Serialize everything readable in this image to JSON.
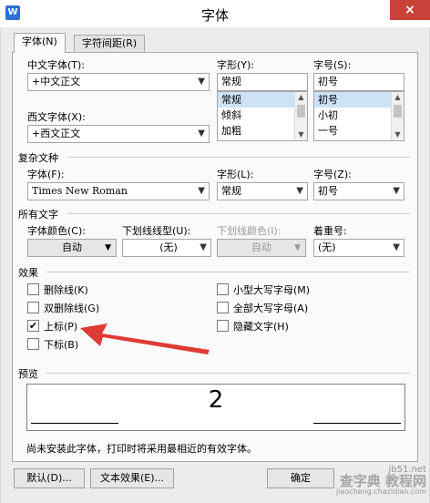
{
  "window": {
    "title": "字体",
    "close_glyph": "×",
    "app_icon_glyph": "W"
  },
  "tabs": [
    {
      "label": "字体(N)",
      "active": true
    },
    {
      "label": "字符间距(R)",
      "active": false
    }
  ],
  "chinese_font": {
    "label": "中文字体(T):",
    "value": "+中文正文"
  },
  "western_font": {
    "label": "西文字体(X):",
    "value": "+西文正文"
  },
  "style": {
    "label": "字形(Y):",
    "value": "常规",
    "options": [
      "常规",
      "倾斜",
      "加粗"
    ],
    "selected": "常规"
  },
  "size": {
    "label": "字号(S):",
    "value": "初号",
    "options": [
      "初号",
      "小初",
      "一号"
    ],
    "selected": "初号"
  },
  "complex": {
    "heading": "复杂文种",
    "font_label": "字体(F):",
    "font_value": "Times New Roman",
    "style_label": "字形(L):",
    "style_value": "常规",
    "size_label": "字号(Z):",
    "size_value": "初号"
  },
  "all_text": {
    "heading": "所有文字",
    "color_label": "字体颜色(C):",
    "color_value": "自动",
    "underline_label": "下划线线型(U):",
    "underline_value": "(无)",
    "underline_color_label": "下划线颜色(I):",
    "underline_color_value": "自动",
    "emphasis_label": "着重号:",
    "emphasis_value": "(无)"
  },
  "effects": {
    "heading": "效果",
    "strikethrough": {
      "label": "删除线(K)",
      "checked": false
    },
    "double_strikethrough": {
      "label": "双删除线(G)",
      "checked": false
    },
    "superscript": {
      "label": "上标(P)",
      "checked": true
    },
    "subscript": {
      "label": "下标(B)",
      "checked": false
    },
    "small_caps": {
      "label": "小型大写字母(M)",
      "checked": false
    },
    "all_caps": {
      "label": "全部大写字母(A)",
      "checked": false
    },
    "hidden": {
      "label": "隐藏文字(H)",
      "checked": false
    }
  },
  "preview": {
    "heading": "预览",
    "sample": "2"
  },
  "note": "尚未安装此字体，打印时将采用最相近的有效字体。",
  "buttons": {
    "default": "默认(D)...",
    "text_effects": "文本效果(E)...",
    "ok": "确定"
  },
  "glyphs": {
    "dropdown": "▼",
    "check": "✔",
    "scroll_up": "▲",
    "scroll_down": "▼"
  },
  "watermark": {
    "line1": "jb51.net",
    "line2": "查字典 教程网",
    "line3": "jiaocheng.chazidian.com"
  },
  "colors": {
    "annotation_arrow": "#e03a34",
    "selection": "#cde2f7",
    "close_button": "#c8423a"
  }
}
